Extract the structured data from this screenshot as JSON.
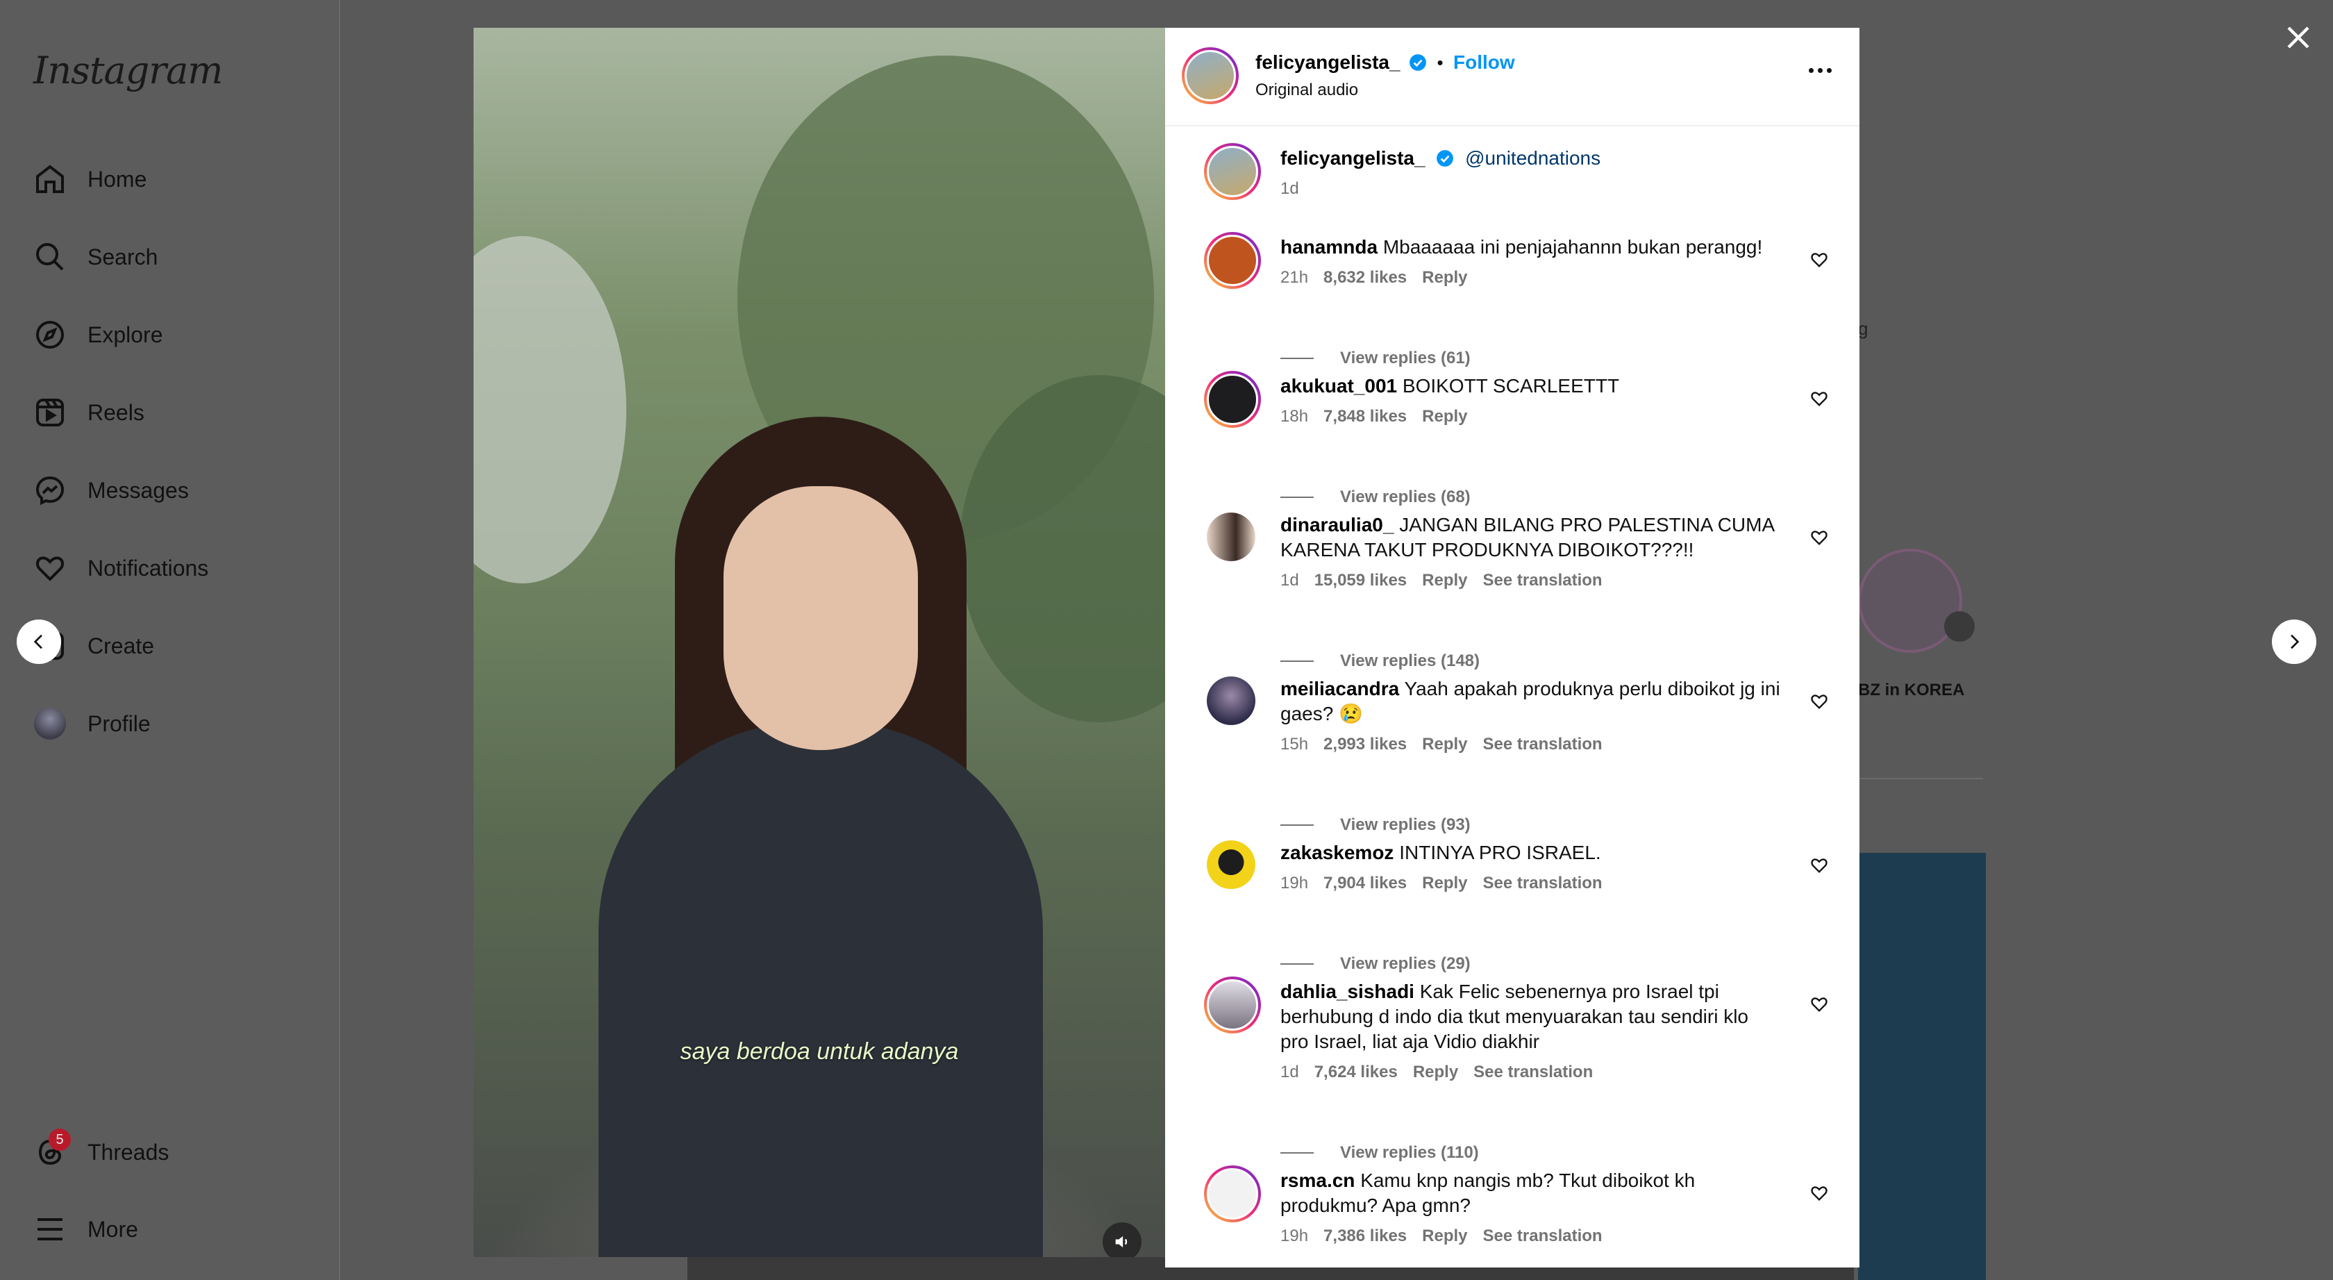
{
  "app": {
    "logo": "Instagram"
  },
  "sidebar": {
    "items": [
      {
        "label": "Home",
        "icon": "home-icon"
      },
      {
        "label": "Search",
        "icon": "search-icon"
      },
      {
        "label": "Explore",
        "icon": "compass-icon"
      },
      {
        "label": "Reels",
        "icon": "reels-icon"
      },
      {
        "label": "Messages",
        "icon": "messenger-icon"
      },
      {
        "label": "Notifications",
        "icon": "heart-icon"
      },
      {
        "label": "Create",
        "icon": "plus-square-icon"
      },
      {
        "label": "Profile",
        "icon": "avatar"
      }
    ],
    "threads": {
      "label": "Threads",
      "badge": "5"
    },
    "more": {
      "label": "More"
    }
  },
  "background": {
    "story_label": "BZ in KOREA",
    "partial_text": "g"
  },
  "video": {
    "caption": "saya berdoa untuk adanya"
  },
  "post": {
    "author": "felicyangelista_",
    "follow_label": "Follow",
    "separator": "•",
    "audio": "Original audio",
    "caption_mention": "@unitednations",
    "caption_time": "1d"
  },
  "comments": [
    {
      "user": "hanamnda",
      "text": "Mbaaaaaa ini penjajahannn bukan perangg!",
      "time": "21h",
      "likes": "8,632 likes",
      "reply": "Reply",
      "translation": "",
      "view_replies": "View replies (61)"
    },
    {
      "user": "akukuat_001",
      "text": "BOIKOTT SCARLEETTT",
      "time": "18h",
      "likes": "7,848 likes",
      "reply": "Reply",
      "translation": "",
      "view_replies": "View replies (68)"
    },
    {
      "user": "dinaraulia0_",
      "text": "JANGAN BILANG PRO PALESTINA CUMA KARENA TAKUT PRODUKNYA DIBOIKOT???!!",
      "time": "1d",
      "likes": "15,059 likes",
      "reply": "Reply",
      "translation": "See translation",
      "view_replies": "View replies (148)"
    },
    {
      "user": "meiliacandra",
      "text": "Yaah apakah produknya perlu diboikot jg ini gaes? 😢",
      "time": "15h",
      "likes": "2,993 likes",
      "reply": "Reply",
      "translation": "See translation",
      "view_replies": "View replies (93)"
    },
    {
      "user": "zakaskemoz",
      "text": "INTINYA PRO ISRAEL.",
      "time": "19h",
      "likes": "7,904 likes",
      "reply": "Reply",
      "translation": "See translation",
      "view_replies": "View replies (29)"
    },
    {
      "user": "dahlia_sishadi",
      "text": "Kak Felic sebenernya pro Israel tpi berhubung d indo dia tkut menyuarakan tau sendiri klo pro Israel, liat aja Vidio diakhir",
      "time": "1d",
      "likes": "7,624 likes",
      "reply": "Reply",
      "translation": "See translation",
      "view_replies": "View replies (110)"
    },
    {
      "user": "rsma.cn",
      "text": "Kamu knp nangis mb? Tkut diboikot kh produkmu? Apa gmn?",
      "time": "19h",
      "likes": "7,386 likes",
      "reply": "Reply",
      "translation": "See translation",
      "view_replies": ""
    }
  ],
  "colors": {
    "accent": "#0095f6",
    "overlay": "#595959",
    "badge": "#b81a2a"
  }
}
